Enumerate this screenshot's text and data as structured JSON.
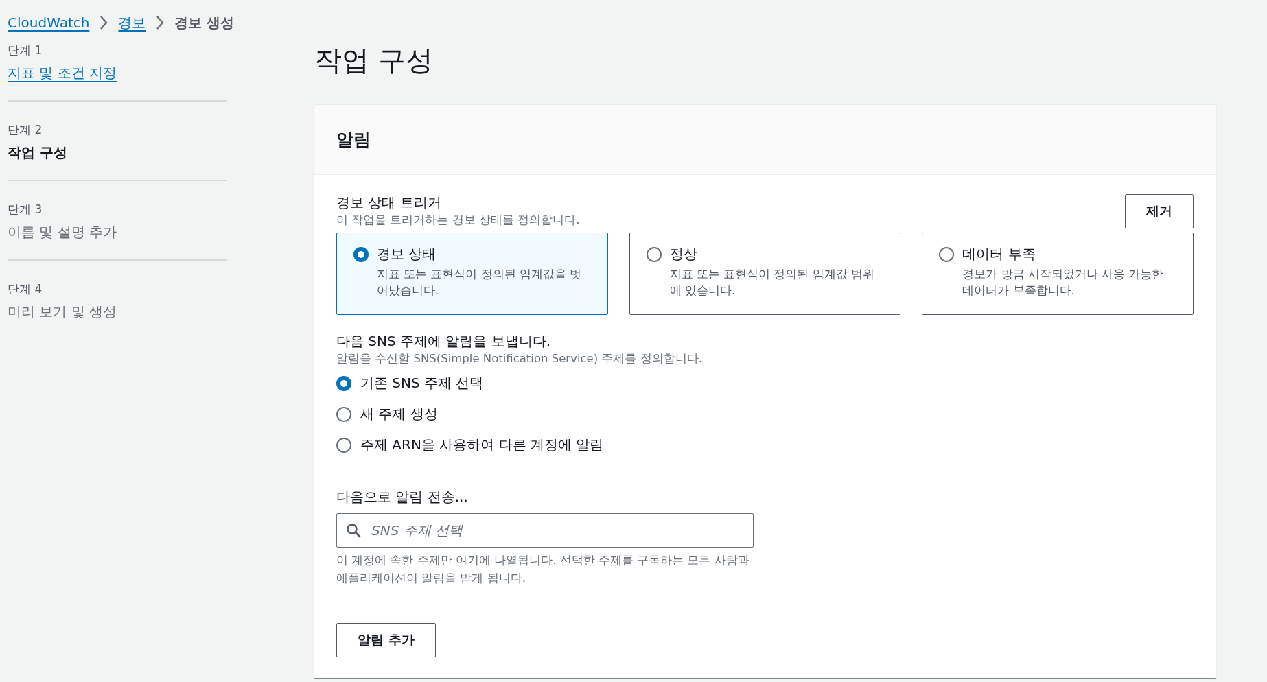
{
  "breadcrumb": [
    {
      "label": "CloudWatch",
      "current": false
    },
    {
      "label": "경보",
      "current": false
    },
    {
      "label": "경보 생성",
      "current": true
    }
  ],
  "steps": [
    {
      "step_label": "단계 1",
      "title": "지표 및 조건 지정",
      "completed": true,
      "current": false
    },
    {
      "step_label": "단계 2",
      "title": "작업 구성",
      "completed": false,
      "current": true
    },
    {
      "step_label": "단계 3",
      "title": "이름 및 설명 추가",
      "completed": false,
      "current": false
    },
    {
      "step_label": "단계 4",
      "title": "미리 보기 및 생성",
      "completed": false,
      "current": false
    }
  ],
  "page_title": "작업 구성",
  "panel": {
    "title": "알림",
    "trigger": {
      "label": "경보 상태 트리거",
      "description": "이 작업을 트리거하는 경보 상태를 정의합니다.",
      "remove_button": "제거",
      "options": [
        {
          "title": "경보 상태",
          "description": "지표 또는 표현식이 정의된 임계값을 벗어났습니다.",
          "selected": true
        },
        {
          "title": "정상",
          "description": "지표 또는 표현식이 정의된 임계값 범위에 있습니다.",
          "selected": false
        },
        {
          "title": "데이터 부족",
          "description": "경보가 방금 시작되었거나 사용 가능한 데이터가 부족합니다.",
          "selected": false
        }
      ]
    },
    "sns": {
      "label": "다음 SNS 주제에 알림을 보냅니다.",
      "description": "알림을 수신할 SNS(Simple Notification Service) 주제를 정의합니다.",
      "options": [
        {
          "label": "기존 SNS 주제 선택",
          "selected": true
        },
        {
          "label": "새 주제 생성",
          "selected": false
        },
        {
          "label": "주제 ARN을 사용하여 다른 계정에 알림",
          "selected": false
        }
      ]
    },
    "send_to": {
      "label": "다음으로 알림 전송...",
      "placeholder": "SNS 주제 선택",
      "hint": "이 계정에 속한 주제만 여기에 나열됩니다. 선택한 주제를 구독하는 모든 사람과 애플리케이션이 알림을 받게 됩니다."
    },
    "add_button": "알림 추가"
  }
}
